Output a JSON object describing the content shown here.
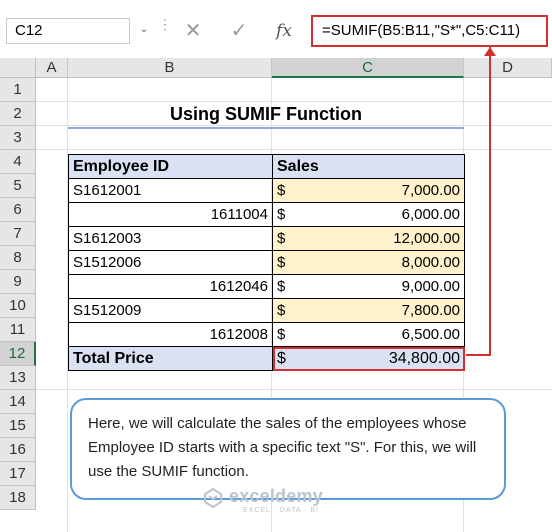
{
  "formula_bar": {
    "name_box": "C12",
    "name_box_arrow": "⌄",
    "cancel_icon": "✕",
    "enter_icon": "✓",
    "fx_label": "fx",
    "formula": "=SUMIF(B5:B11,\"S*\",C5:C11)"
  },
  "columns": [
    "A",
    "B",
    "C",
    "D"
  ],
  "rows": [
    "1",
    "2",
    "3",
    "4",
    "5",
    "6",
    "7",
    "8",
    "9",
    "10",
    "11",
    "12",
    "13",
    "14",
    "15",
    "16",
    "17",
    "18"
  ],
  "title": "Using SUMIF Function",
  "table": {
    "headers": [
      "Employee ID",
      "Sales"
    ],
    "rows": [
      {
        "id": "S1612001",
        "currency": "$",
        "amount": "7,000.00"
      },
      {
        "id": "1611004",
        "currency": "$",
        "amount": "6,000.00"
      },
      {
        "id": "S1612003",
        "currency": "$",
        "amount": "12,000.00"
      },
      {
        "id": "S1512006",
        "currency": "$",
        "amount": "8,000.00"
      },
      {
        "id": "1612046",
        "currency": "$",
        "amount": "9,000.00"
      },
      {
        "id": "S1512009",
        "currency": "$",
        "amount": "7,800.00"
      },
      {
        "id": "1612008",
        "currency": "$",
        "amount": "6,500.00"
      }
    ],
    "total": {
      "label": "Total Price",
      "currency": "$",
      "amount": "34,800.00"
    }
  },
  "note": "Here, we will calculate the sales of the employees whose Employee ID starts with a specific text \"S\". For this, we will use the SUMIF function.",
  "watermark": {
    "name": "exceldemy",
    "tagline": "EXCEL · DATA · BI"
  },
  "colors": {
    "highlight": "#fff2cc",
    "header_fill": "#d9e1f2",
    "accent_red": "#d32f2f",
    "note_border": "#5b9bd5"
  }
}
